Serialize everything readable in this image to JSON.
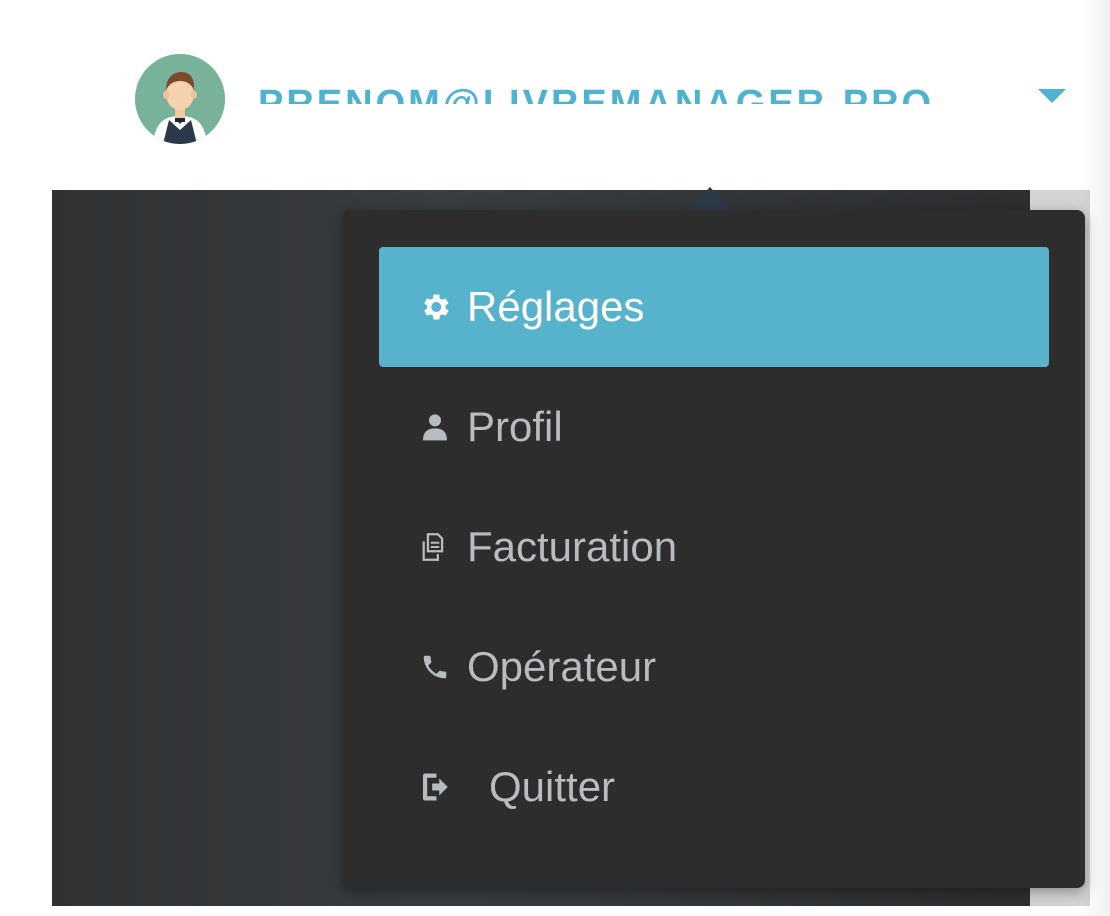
{
  "header": {
    "username": "PRENOM@LIVREMANAGER-PRO"
  },
  "menu": {
    "items": [
      {
        "label": "Réglages",
        "icon": "gear-icon",
        "active": true
      },
      {
        "label": "Profil",
        "icon": "user-icon",
        "active": false
      },
      {
        "label": "Facturation",
        "icon": "copy-documents-icon",
        "active": false
      },
      {
        "label": "Opérateur",
        "icon": "phone-icon",
        "active": false
      },
      {
        "label": "Quitter",
        "icon": "sign-out-icon",
        "active": false
      }
    ]
  },
  "colors": {
    "accent": "#57b3cc",
    "menu_bg": "#2d2d2d",
    "menu_text": "#b8bcc0",
    "active_text": "#ffffff"
  }
}
